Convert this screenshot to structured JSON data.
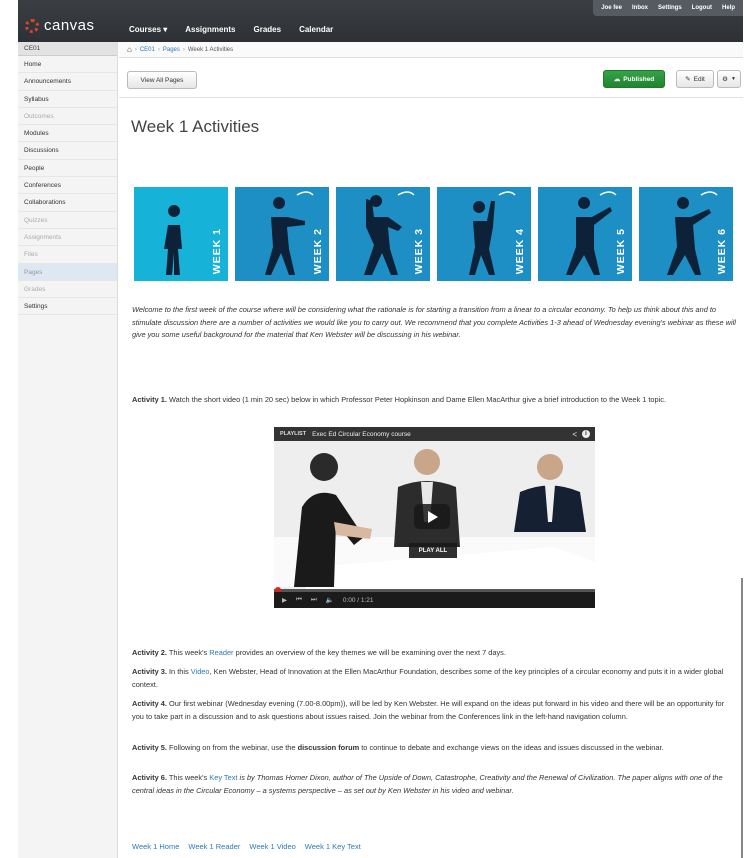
{
  "header": {
    "logo": "canvas",
    "nav": [
      "Courses ▾",
      "Assignments",
      "Grades",
      "Calendar"
    ],
    "user_links": [
      "Joe fee",
      "Inbox",
      "Settings",
      "Logout",
      "Help"
    ]
  },
  "sidebar": {
    "course": "CE01",
    "items": [
      {
        "label": "Home",
        "state": "normal"
      },
      {
        "label": "Announcements",
        "state": "normal"
      },
      {
        "label": "Syllabus",
        "state": "normal"
      },
      {
        "label": "Outcomes",
        "state": "dim"
      },
      {
        "label": "Modules",
        "state": "normal"
      },
      {
        "label": "Discussions",
        "state": "normal"
      },
      {
        "label": "People",
        "state": "normal"
      },
      {
        "label": "Conferences",
        "state": "normal"
      },
      {
        "label": "Collaborations",
        "state": "normal"
      },
      {
        "label": "Quizzes",
        "state": "dim"
      },
      {
        "label": "Assignments",
        "state": "dim"
      },
      {
        "label": "Files",
        "state": "dim"
      },
      {
        "label": "Pages",
        "state": "active"
      },
      {
        "label": "Grades",
        "state": "dim"
      },
      {
        "label": "Settings",
        "state": "normal"
      }
    ]
  },
  "breadcrumb": {
    "course": "CE01",
    "pages": "Pages",
    "current": "Week 1 Activities"
  },
  "toolbar": {
    "view_all": "View All Pages",
    "published": "Published",
    "edit": "Edit",
    "gear": "⚙"
  },
  "page": {
    "title": "Week 1 Activities",
    "weeks": [
      "WEEK 1",
      "WEEK 2",
      "WEEK 3",
      "WEEK 4",
      "WEEK 5",
      "WEEK 6"
    ],
    "intro": "Welcome to the first week of the course where will be considering what the rationale is for starting a transition from a linear to a circular economy. To help us think about this and to stimulate discussion there are a number of activities we would like you to carry out.  We recommend that you complete Activities 1-3 ahead of Wednesday evening's webinar as these will give you some useful background for the material that Ken Webster will be discussing in his webinar.",
    "a1_label": "Activity 1.",
    "a1_text": " Watch the short video (1 min 20 sec) below in which Professor Peter Hopkinson and Dame Ellen MacArthur give a brief introduction to the Week 1 topic.",
    "video": {
      "playlist": "PLAYLIST",
      "title": "Exec Ed Circular Economy course",
      "play_all": "PLAY ALL",
      "time": "0:00 / 1:21"
    },
    "a2_label": "Activity 2.",
    "a2_pre": " This week's ",
    "a2_link": "Reader",
    "a2_post": " provides an overview of the key themes we will be examining over the next 7 days.",
    "a3_label": "Activity 3.",
    "a3_pre": " In this ",
    "a3_link": "Video",
    "a3_post": ", Ken Webster, Head of Innovation at the Ellen MacArthur Foundation, describes some of the key principles of a circular economy and puts it in a wider global context.",
    "a4_label": "Activity 4.",
    "a4_text": " Our first webinar (Wednesday evening (7.00-8.00pm)), will be led by Ken Webster. He will expand on the ideas put forward in his video and there will be an opportunity for you to take part in a discussion and to ask questions about issues raised. Join the webinar from the Conferences link in the left-hand navigation column.",
    "a5_label": "Activity 5.",
    "a5_pre": " Following on from the webinar, use the ",
    "a5_bold": "discussion forum",
    "a5_post": " to continue to debate and exchange views on the ideas and issues discussed in the webinar.",
    "a6_label": "Activity 6.",
    "a6_pre": " This week's ",
    "a6_link": "Key Text",
    "a6_post": " is by Thomas Homer Dixon, author of The Upside of Down, Catastrophe, Creativity and the Renewal of Civilization. The paper  aligns with one of the central ideas in the Circular Economy – a systems perspective –  as set out by Ken Webster in his video and webinar.",
    "footer_links": [
      "Week 1 Home",
      "Week 1 Reader",
      "Week 1 Video",
      "Week 1 Key Text"
    ]
  },
  "colors": {
    "header": "#2d3034",
    "week_tile": "#1d8fc4",
    "week_tile_first": "#17b2d8",
    "link": "#2a7ab8",
    "published": "#22842f"
  }
}
